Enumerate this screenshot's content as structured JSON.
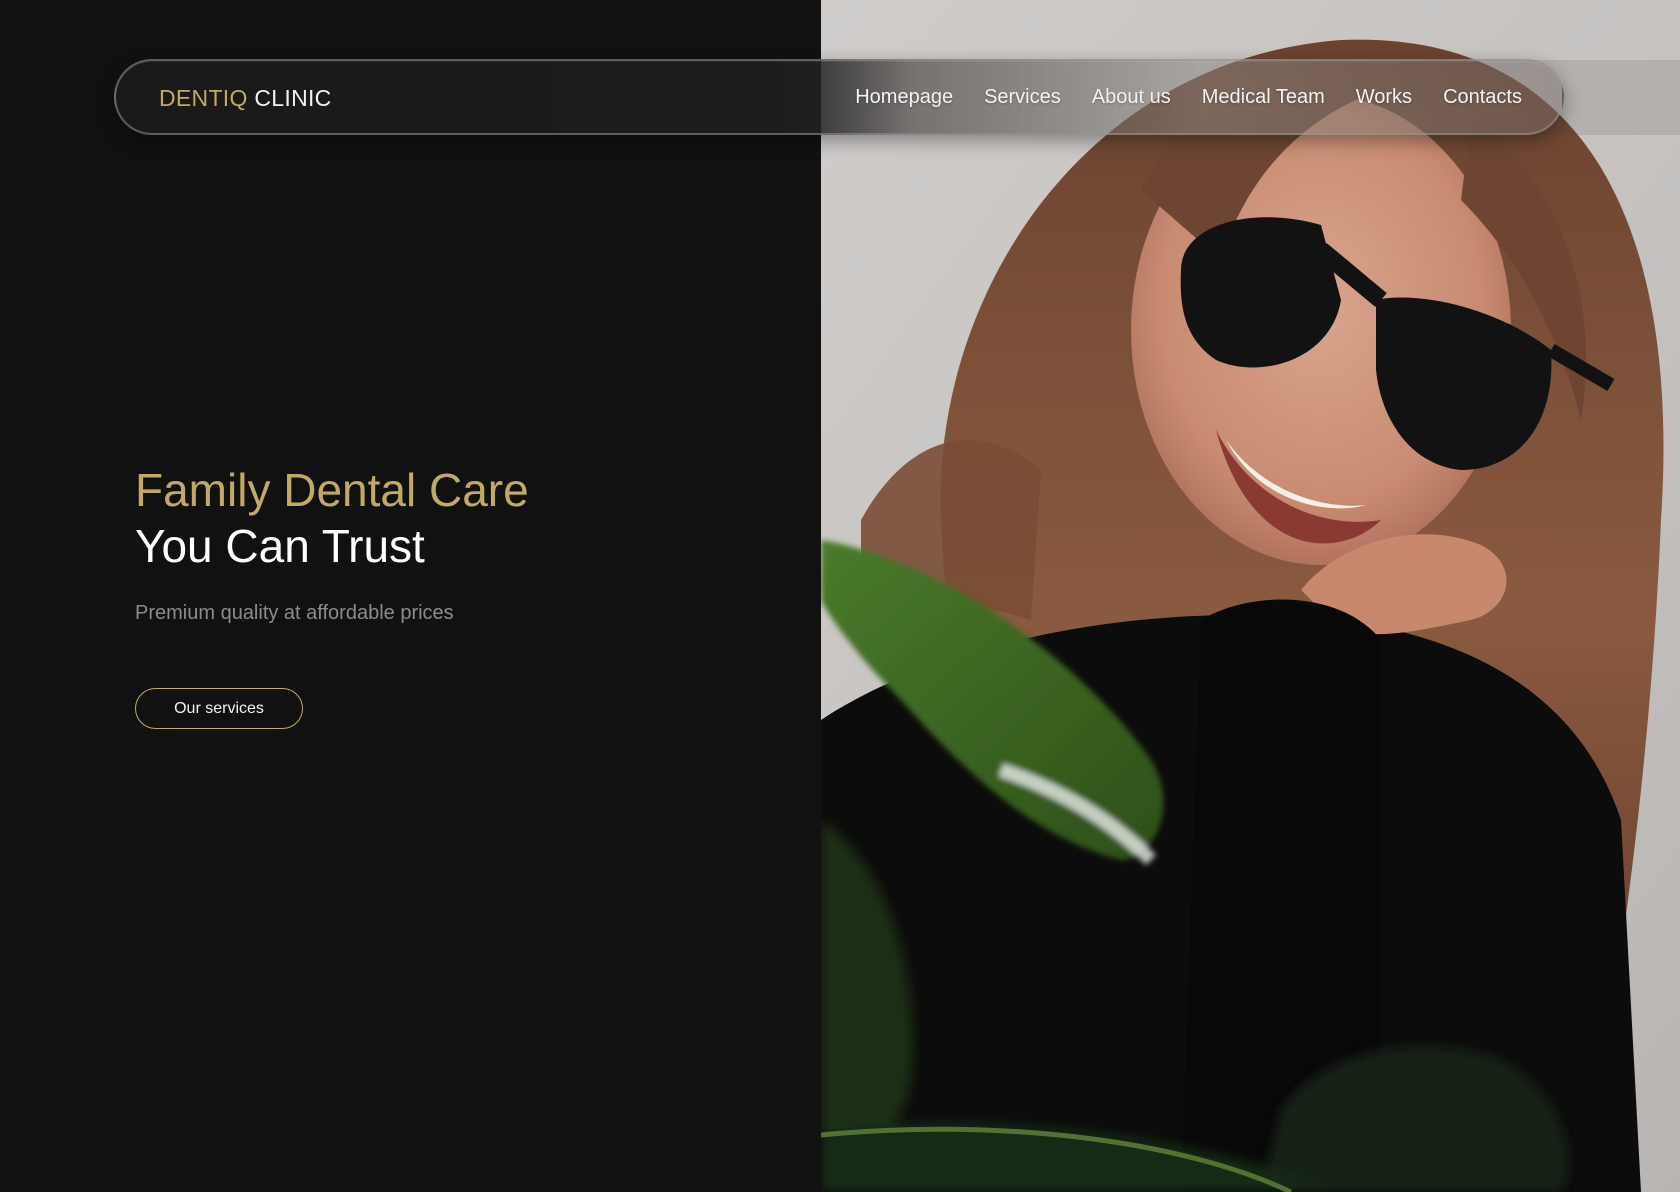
{
  "header": {
    "logo_part1": "DENTIQ",
    "logo_part2": " CLINIC",
    "nav": [
      {
        "label": "Homepage"
      },
      {
        "label": "Services"
      },
      {
        "label": "About us"
      },
      {
        "label": "Medical Team"
      },
      {
        "label": "Works"
      },
      {
        "label": "Contacts"
      }
    ]
  },
  "hero": {
    "title_line1": "Family Dental Care",
    "title_line2": "You Can Trust",
    "subtitle": "Premium quality at affordable prices",
    "cta_label": "Our services",
    "image_icon": "smiling-woman-with-sunglasses-photo"
  },
  "colors": {
    "background": "#111111",
    "accent_gold": "#c2aa63",
    "text_white": "#ffffff",
    "text_muted": "#8c8c8c"
  }
}
